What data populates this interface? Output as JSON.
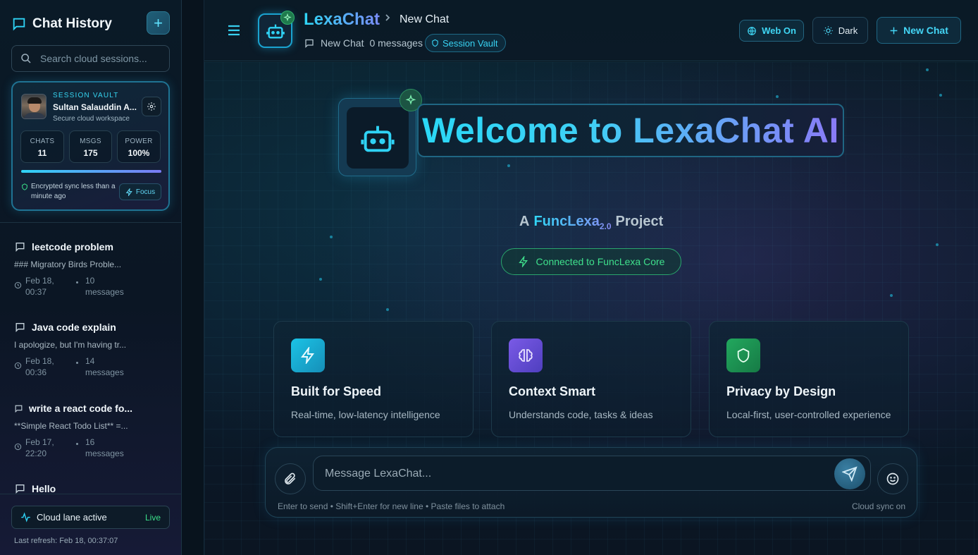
{
  "sidebar": {
    "title": "Chat History",
    "new_button": "+",
    "search_placeholder": "Search cloud sessions...",
    "vault": {
      "label": "SESSION VAULT",
      "name": "Sultan Salauddin A...",
      "subtitle": "Secure cloud workspace",
      "stats": [
        {
          "key": "CHATS",
          "value": "11"
        },
        {
          "key": "MSGS",
          "value": "175"
        },
        {
          "key": "POWER",
          "value": "100%"
        }
      ],
      "power_fraction": 1.0,
      "sync_text": "Encrypted sync less than a minute ago",
      "focus_label": "Focus"
    },
    "history": [
      {
        "title": "leetcode problem",
        "preview": "### Migratory Birds Proble...",
        "date": "Feb 18, 00:37",
        "count": "10 messages"
      },
      {
        "title": "Java code explain",
        "preview": "I apologize, but I'm having tr...",
        "date": "Feb 18, 00:36",
        "count": "14 messages"
      },
      {
        "title": "write a react code fo...",
        "preview": "**Simple React Todo List** =...",
        "date": "Feb 17, 22:20",
        "count": "16 messages"
      },
      {
        "title": "Hello",
        "preview": "",
        "date": "",
        "count": ""
      }
    ],
    "lane": {
      "label": "Cloud lane active",
      "status": "Live"
    },
    "last_refresh": "Last refresh: Feb 18, 00:37:07"
  },
  "header": {
    "brand": "LexaChat",
    "crumb_sep": ">",
    "crumb_current": "New Chat",
    "chat_name": "New Chat",
    "message_count": "0 messages",
    "vault_badge": "Session Vault",
    "web_label": "Web On",
    "theme_label": "Dark",
    "new_chat_label": "New Chat"
  },
  "hero": {
    "title": "Welcome to LexaChat AI",
    "tag_prefix": "A",
    "tag_name": "FuncLexa",
    "tag_version": "2.0",
    "tag_suffix": "Project",
    "connected": "Connected to FuncLexa Core"
  },
  "features": [
    {
      "title": "Built for Speed",
      "desc": "Real-time, low-latency intelligence",
      "icon": "lightning-icon",
      "color": "#19b8dc"
    },
    {
      "title": "Context Smart",
      "desc": "Understands code, tasks & ideas",
      "icon": "brain-icon",
      "color": "#6a4fd8"
    },
    {
      "title": "Privacy by Design",
      "desc": "Local-first, user-controlled experience",
      "icon": "shield-icon",
      "color": "#1f9a55"
    }
  ],
  "composer": {
    "placeholder": "Message LexaChat...",
    "hint": "Enter to send • Shift+Enter for new line • Paste files to attach",
    "cloud": "Cloud sync on"
  },
  "colors": {
    "accent": "#2ed6f5",
    "violet": "#8a7af7",
    "live": "#3be08a"
  }
}
